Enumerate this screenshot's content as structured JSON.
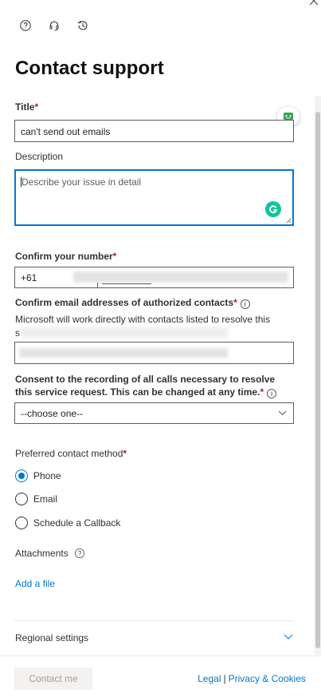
{
  "header": {
    "title": "Contact support",
    "icons": [
      "help-icon",
      "headset-icon",
      "history-icon",
      "close-icon"
    ]
  },
  "form": {
    "title_label": "Title",
    "title_required": "*",
    "title_value": "can't send out emails",
    "description_label": "Description",
    "description_placeholder": "Describe your issue in detail",
    "phone_label": "Confirm your number",
    "phone_required": "*",
    "phone_prefix": "+61",
    "emails_label": "Confirm email addresses of authorized contacts",
    "emails_required": "*",
    "emails_hint": "Microsoft will work directly with contacts listed to resolve this",
    "emails_hint_tail": "s",
    "consent_label": "Consent to the recording of all calls necessary to resolve this service request. This can be changed at any time.",
    "consent_required": "*",
    "consent_value": "--choose one--",
    "method_label": "Preferred contact method",
    "method_required": "*",
    "methods": [
      {
        "label": "Phone",
        "selected": true
      },
      {
        "label": "Email",
        "selected": false
      },
      {
        "label": "Schedule a Callback",
        "selected": false
      }
    ],
    "attachments_label": "Attachments",
    "add_file": "Add a file",
    "regional_label": "Regional settings"
  },
  "footer": {
    "contact_button": "Contact me",
    "legal": "Legal",
    "separator": "|",
    "privacy": "Privacy & Cookies"
  },
  "colors": {
    "accent": "#0078d4",
    "required": "#a4262c",
    "grammarly": "#15c39a"
  }
}
